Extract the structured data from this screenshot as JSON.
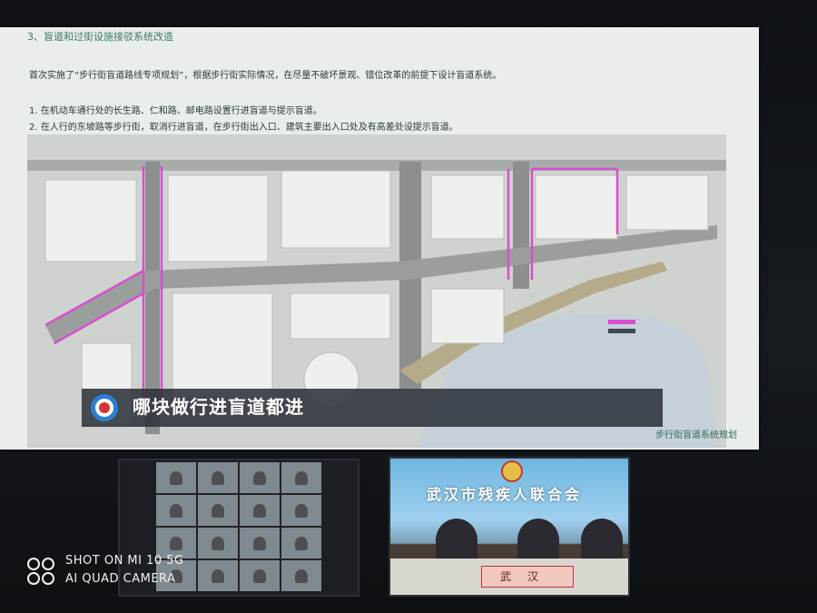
{
  "slide": {
    "heading": "3、盲道和过街设施接驳系统改造",
    "intro": "首次实施了“步行街盲道路线专项规划”，根据步行街实际情况，在尽量不破坏景观、错位改革的前提下设计盲道系统。",
    "items": [
      "1. 在机动车通行处的长生路、仁和路、邮电路设置行进盲道与提示盲道。",
      "2. 在人行的东坡路等步行街，取消行进盲道，在步行街出入口、建筑主要出入口处及有高差处设提示盲道。"
    ],
    "caption": "哪块做行进盲道都进",
    "footer_note": "步行街盲道系统规划"
  },
  "colors": {
    "accent_magenta": "#d84fd0",
    "road_gray": "#8b8f8d",
    "water": "#c8d2dc",
    "caption_bg": "#2d323a"
  },
  "video_tiles": {
    "gallery": {
      "label": ""
    },
    "room": {
      "banner": "武汉市残疾人联合会",
      "nameplate": "武汉"
    }
  },
  "watermark": {
    "line1": "SHOT ON MI 10 5G",
    "line2": "AI QUAD CAMERA",
    "logo_icon": "dual-circle-camera-icon"
  }
}
